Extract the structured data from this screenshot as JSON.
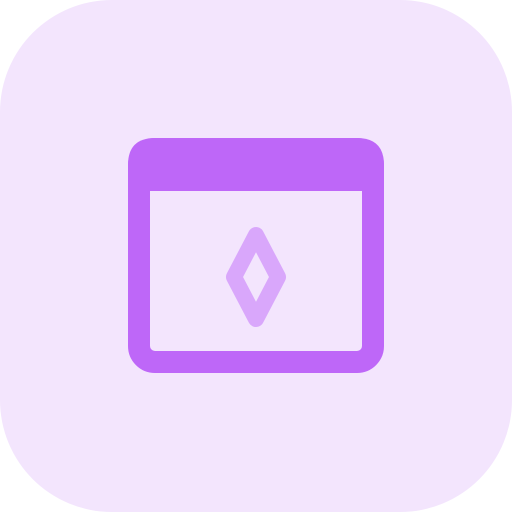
{
  "icon": {
    "name": "browser-window-diamond-icon",
    "colors": {
      "tile_background": "#F3E5FD",
      "window_stroke": "#BE67F8",
      "diamond_stroke": "#D9A7FB"
    }
  }
}
